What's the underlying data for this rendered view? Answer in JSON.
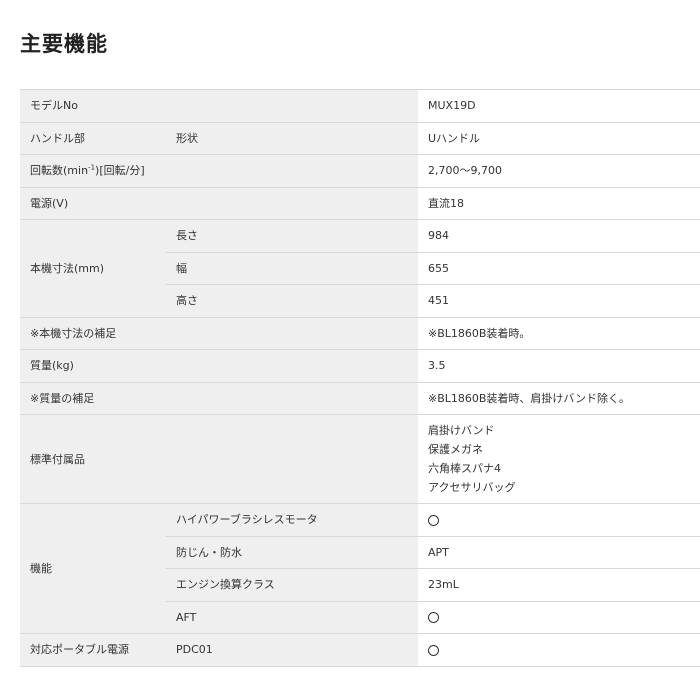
{
  "title": "主要機能",
  "rows": {
    "model": {
      "label": "モデルNo",
      "value": "MUX19D"
    },
    "handle": {
      "label": "ハンドル部",
      "sub": "形状",
      "value": "Uハンドル"
    },
    "rpm": {
      "label_pre": "回転数(min",
      "label_sup": "-1",
      "label_post": ")[回転/分]",
      "value": "2,700〜9,700"
    },
    "power": {
      "label": "電源(V)",
      "value": "直流18"
    },
    "dims": {
      "label": "本機寸法(mm)",
      "length_label": "長さ",
      "length": "984",
      "width_label": "幅",
      "width": "655",
      "height_label": "高さ",
      "height": "451"
    },
    "dims_note": {
      "label": "※本機寸法の補足",
      "value": "※BL1860B装着時。"
    },
    "mass": {
      "label": "質量(kg)",
      "value": "3.5"
    },
    "mass_note": {
      "label": "※質量の補足",
      "value": "※BL1860B装着時、肩掛けバンド除く。"
    },
    "accessories": {
      "label": "標準付属品",
      "items": [
        "肩掛けバンド",
        "保護メガネ",
        "六角棒スパナ4",
        "アクセサリバッグ"
      ]
    },
    "features": {
      "label": "機能",
      "motor_label": "ハイパワーブラシレスモータ",
      "motor": "○",
      "dust_label": "防じん・防水",
      "dust": "APT",
      "engine_label": "エンジン換算クラス",
      "engine": "23mL",
      "aft_label": "AFT",
      "aft": "○"
    },
    "portable": {
      "label": "対応ポータブル電源",
      "sub": "PDC01",
      "value": "○"
    }
  }
}
